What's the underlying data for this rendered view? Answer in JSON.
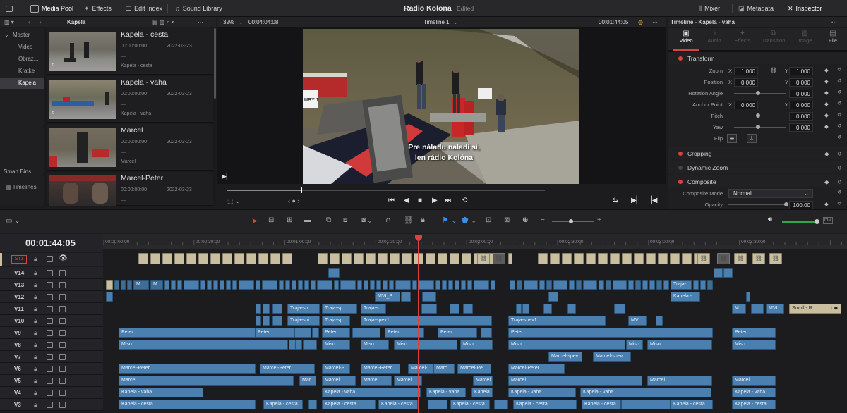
{
  "toolbar": {
    "media_pool": "Media Pool",
    "effects": "Effects",
    "edit_index": "Edit Index",
    "sound_library": "Sound Library",
    "project_title": "Radio Kolona",
    "edited": "Edited",
    "mixer": "Mixer",
    "metadata": "Metadata",
    "inspector": "Inspector"
  },
  "media_pool": {
    "folder": "Kapela",
    "bins": [
      "Master",
      "Video",
      "Obraz...",
      "Kratke",
      "Kapela"
    ],
    "smart_bins": "Smart Bins",
    "timelines": "Timelines",
    "clips": [
      {
        "name": "Kapela - cesta",
        "tc": "00:00:00:00",
        "date": "2022-03-23",
        "dash": "—",
        "sub": "Kapela - cesta"
      },
      {
        "name": "Kapela - vaha",
        "tc": "00:00:00:00",
        "date": "2022-03-23",
        "dash": "—",
        "sub": "Kapela - vaha"
      },
      {
        "name": "Marcel",
        "tc": "00:00:00:00",
        "date": "2022-03-23",
        "dash": "—",
        "sub": "Marcel"
      },
      {
        "name": "Marcel-Peter",
        "tc": "00:00:00:00",
        "date": "2022-03-23",
        "dash": "—",
        "sub": ""
      }
    ]
  },
  "viewer": {
    "zoom": "32%",
    "duration": "00:04:04:08",
    "timeline_name": "Timeline 1",
    "timecode": "00:01:44:05",
    "subtitle_line1": "Pre náladu naladí si,",
    "subtitle_line2": "len rádio Kolóna",
    "sign_text": "UBY 1"
  },
  "inspector": {
    "header": "Timeline - Kapela - vaha",
    "tabs": [
      "Video",
      "Audio",
      "Effects",
      "Transition",
      "Image",
      "File"
    ],
    "transform": "Transform",
    "zoom_label": "Zoom",
    "zoom_x": "1.000",
    "zoom_y": "1.000",
    "position_label": "Position",
    "position_x": "0.000",
    "position_y": "0.000",
    "rotation_label": "Rotation Angle",
    "rotation": "0.000",
    "anchor_label": "Anchor Point",
    "anchor_x": "0.000",
    "anchor_y": "0.000",
    "pitch_label": "Pitch",
    "pitch": "0.000",
    "yaw_label": "Yaw",
    "yaw": "0.000",
    "flip_label": "Flip",
    "x": "X",
    "y": "Y",
    "cropping": "Cropping",
    "dynamic_zoom": "Dynamic Zoom",
    "composite": "Composite",
    "composite_mode_label": "Composite Mode",
    "composite_mode": "Normal",
    "opacity_label": "Opacity",
    "opacity": "100.00"
  },
  "timeline": {
    "timecode": "00:01:44:05",
    "ruler": [
      "00:00:00:00",
      "00:00:30:00",
      "00:01:00:00",
      "00:01:30:00",
      "00:02:00:00",
      "00:02:30:00",
      "00:03:00:00",
      "00:03:30:00"
    ],
    "subtitle_track": "ST1",
    "tracks": [
      "V14",
      "V13",
      "V12",
      "V11",
      "V10",
      "V9",
      "V8",
      "V7",
      "V6",
      "V5",
      "V4",
      "V3"
    ],
    "smart_clip": "Smoll - R...",
    "dim": "DIM"
  },
  "colors": {
    "accent_red": "#e0403c",
    "clip_blue": "#4a7fb0",
    "subtitle_clip": "#c9bea0"
  }
}
